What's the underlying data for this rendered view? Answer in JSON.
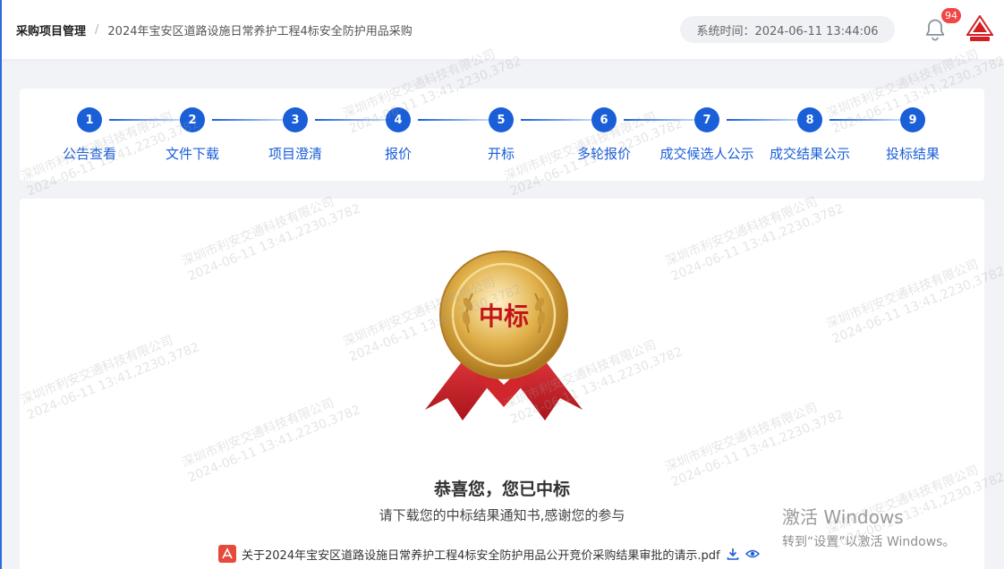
{
  "header": {
    "breadcrumb_root": "采购项目管理",
    "breadcrumb_sep": "/",
    "breadcrumb_current": "2024年宝安区道路设施日常养护工程4标安全防护用品采购",
    "system_time": "系统时间：2024-06-11 13:44:06",
    "notification_count": "94"
  },
  "steps": [
    {
      "number": "1",
      "label": "公告查看"
    },
    {
      "number": "2",
      "label": "文件下载"
    },
    {
      "number": "3",
      "label": "项目澄清"
    },
    {
      "number": "4",
      "label": "报价"
    },
    {
      "number": "5",
      "label": "开标"
    },
    {
      "number": "6",
      "label": "多轮报价"
    },
    {
      "number": "7",
      "label": "成交候选人公示"
    },
    {
      "number": "8",
      "label": "成交结果公示"
    },
    {
      "number": "9",
      "label": "投标结果"
    }
  ],
  "result": {
    "medal_text": "中标",
    "title": "恭喜您，您已中标",
    "subtitle": "请下载您的中标结果通知书,感谢您的参与",
    "file_name": "关于2024年宝安区道路设施日常养护工程4标安全防护用品公开竞价采购结果审批的请示.pdf"
  },
  "watermark": {
    "line1": "深圳市利安交通科技有限公司",
    "line2": "2024-06-11 13:41,2230,3782"
  },
  "windows_activation": {
    "title": "激活 Windows",
    "subtitle": "转到“设置”以激活 Windows。"
  },
  "colors": {
    "primary": "#1a5fd8",
    "badge": "#f24545",
    "pdf": "#e64a3b",
    "medal_gold": "#d9a531",
    "medal_text": "#c4151c",
    "ribbon": "#cf1f28"
  }
}
